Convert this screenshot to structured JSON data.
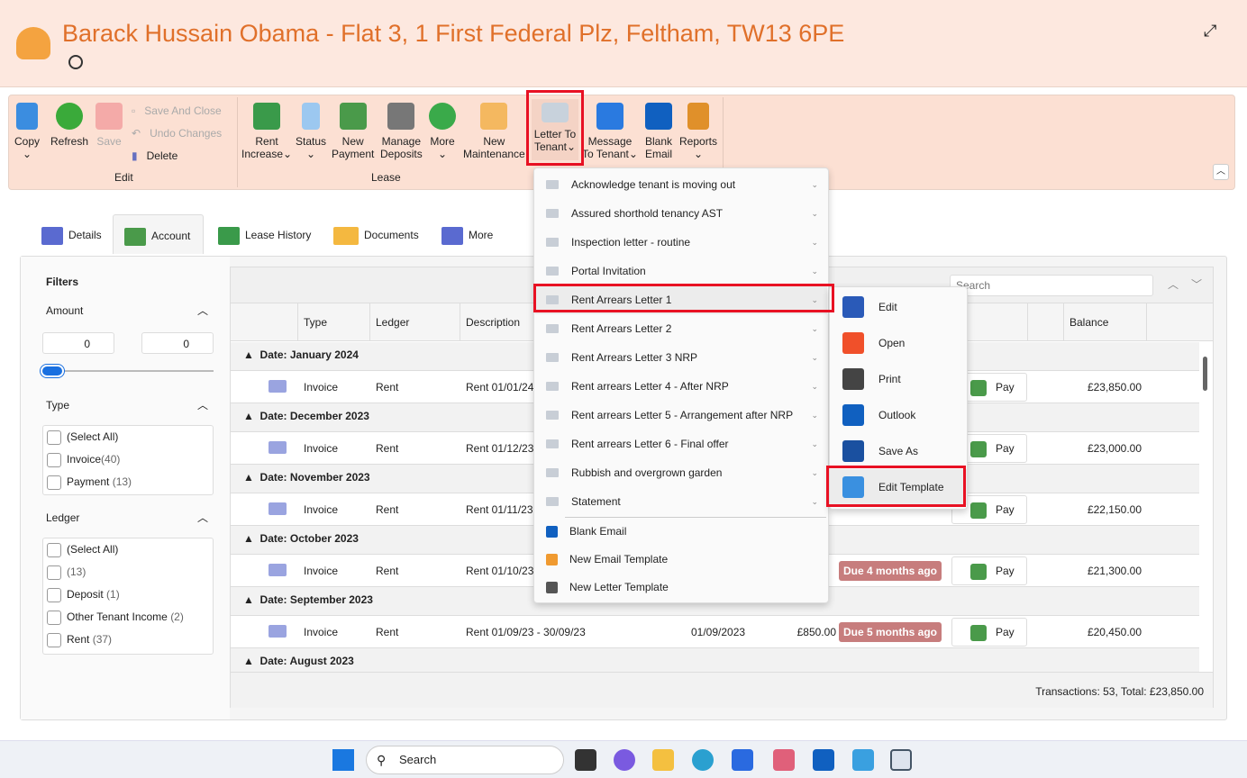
{
  "header": {
    "title": "Barack Hussain Obama - Flat 3, 1 First Federal Plz, Feltham, TW13 6PE"
  },
  "ribbon": {
    "edit": {
      "copy": "Copy",
      "refresh": "Refresh",
      "save": "Save",
      "save_close": "Save And Close",
      "undo": "Undo Changes",
      "delete": "Delete",
      "group": "Edit"
    },
    "lease": {
      "rent_increase": [
        "Rent",
        "Increase"
      ],
      "status": "Status",
      "new_payment": [
        "New",
        "Payment"
      ],
      "manage_deposits": [
        "Manage",
        "Deposits"
      ],
      "more": "More",
      "new_maintenance": [
        "New",
        "Maintenance"
      ],
      "group": "Lease"
    },
    "letter": [
      "Letter To",
      "Tenant"
    ],
    "message": [
      "Message",
      "To Tenant"
    ],
    "blank_email": [
      "Blank",
      "Email"
    ],
    "reports": "Reports"
  },
  "tabs": [
    "Details",
    "Account",
    "Lease History",
    "Documents",
    "More"
  ],
  "filters": {
    "title": "Filters",
    "amount": "Amount",
    "amount_min": "0",
    "amount_max": "0",
    "type": "Type",
    "type_items": [
      {
        "label": "(Select All)",
        "count": ""
      },
      {
        "label": "Invoice",
        "count": "(40)"
      },
      {
        "label": "Payment",
        "count": "(13)"
      }
    ],
    "ledger": "Ledger",
    "ledger_items": [
      {
        "label": "(Select All)",
        "count": ""
      },
      {
        "label": "",
        "count": "(13)"
      },
      {
        "label": "Deposit",
        "count": "(1)"
      },
      {
        "label": "Other Tenant Income",
        "count": "(2)"
      },
      {
        "label": "Rent",
        "count": "(37)"
      }
    ]
  },
  "grid": {
    "search_placeholder": "Search",
    "columns": [
      "Type",
      "Ledger",
      "Description",
      "Balance"
    ],
    "groups": [
      {
        "title": "Date: January 2024",
        "type": "Invoice",
        "ledger": "Rent",
        "description": "Rent 01/01/24",
        "date": "",
        "amount": "",
        "status": "",
        "pay": "Pay",
        "balance": "£23,850.00"
      },
      {
        "title": "Date: December 2023",
        "type": "Invoice",
        "ledger": "Rent",
        "description": "Rent 01/12/23",
        "date": "",
        "amount": "",
        "status": "",
        "pay": "Pay",
        "balance": "£23,000.00"
      },
      {
        "title": "Date: November 2023",
        "type": "Invoice",
        "ledger": "Rent",
        "description": "Rent 01/11/23",
        "date": "",
        "amount": "",
        "status": "",
        "pay": "Pay",
        "balance": "£22,150.00"
      },
      {
        "title": "Date: October 2023",
        "type": "Invoice",
        "ledger": "Rent",
        "description": "Rent 01/10/23",
        "date": "",
        "amount": "",
        "status": "Due 4 months ago",
        "pay": "Pay",
        "balance": "£21,300.00"
      },
      {
        "title": "Date: September 2023",
        "type": "Invoice",
        "ledger": "Rent",
        "description": "Rent 01/09/23 - 30/09/23",
        "date": "01/09/2023",
        "amount": "£850.00",
        "status": "Due 5 months ago",
        "pay": "Pay",
        "balance": "£20,450.00"
      }
    ],
    "last_group": "Date: August 2023",
    "footer": "Transactions: 53, Total: £23,850.00"
  },
  "letter_menu": {
    "items": [
      "Acknowledge tenant is moving out",
      "Assured shorthold tenancy AST",
      "Inspection letter - routine",
      "Portal Invitation",
      "Rent Arrears Letter 1",
      "Rent Arrears Letter 2",
      "Rent Arrears Letter 3 NRP",
      "Rent arrears Letter 4 - After NRP",
      "Rent arrears Letter 5 - Arrangement after NRP",
      "Rent arrears Letter 6 - Final offer",
      "Rubbish and overgrown garden",
      "Statement"
    ],
    "extra": [
      "Blank Email",
      "New Email Template",
      "New Letter Template"
    ]
  },
  "submenu": [
    "Edit",
    "Open",
    "Print",
    "Outlook",
    "Save As",
    "Edit Template"
  ],
  "taskbar": {
    "search": "Search"
  },
  "colors": {
    "accent": "#e0702a",
    "header_bg": "#fde8df",
    "highlight": "#e81123",
    "badge": "#c77d7d"
  }
}
